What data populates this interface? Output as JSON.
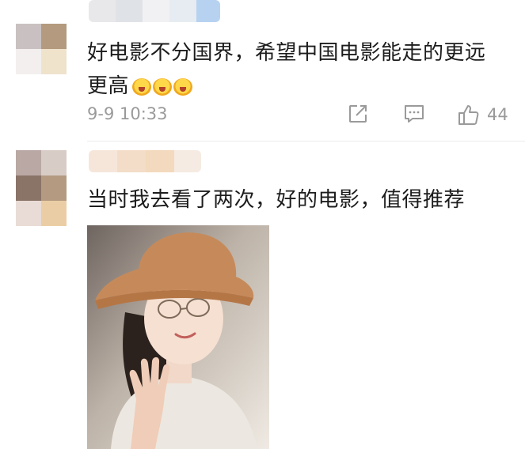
{
  "comments": [
    {
      "text": "好电影不分国界，希望中国电影能走的更远",
      "text_line2": "更高",
      "emojis": [
        "laughing-crying-emoji",
        "laughing-crying-emoji",
        "laughing-crying-emoji"
      ],
      "timestamp": "9-9 10:33",
      "like_count": "44",
      "avatar_colors": [
        "#c9c1c1",
        "#b49a7e",
        "#f3efee",
        "#efe3cc"
      ],
      "name_colors": [
        "#e8e8ea",
        "#dfe2e7",
        "#f1f1f3",
        "#e6ecf2",
        "#b7d2f0"
      ]
    },
    {
      "text": "当时我去看了两次，好的电影，值得推荐",
      "avatar_colors": [
        "#b9a8a4",
        "#8a7468",
        "#e9dcd6",
        "#ebcda5"
      ],
      "name_colors": [
        "#f6e6da",
        "#f3ddc8",
        "#f3d9bd",
        "#f5ebe2"
      ]
    }
  ],
  "icons": {
    "share": "share-icon",
    "comment": "comment-icon",
    "like": "thumbs-up-icon"
  },
  "colors": {
    "text": "#1c1c1c",
    "meta": "#9a9a9a",
    "divider": "#ececec"
  }
}
